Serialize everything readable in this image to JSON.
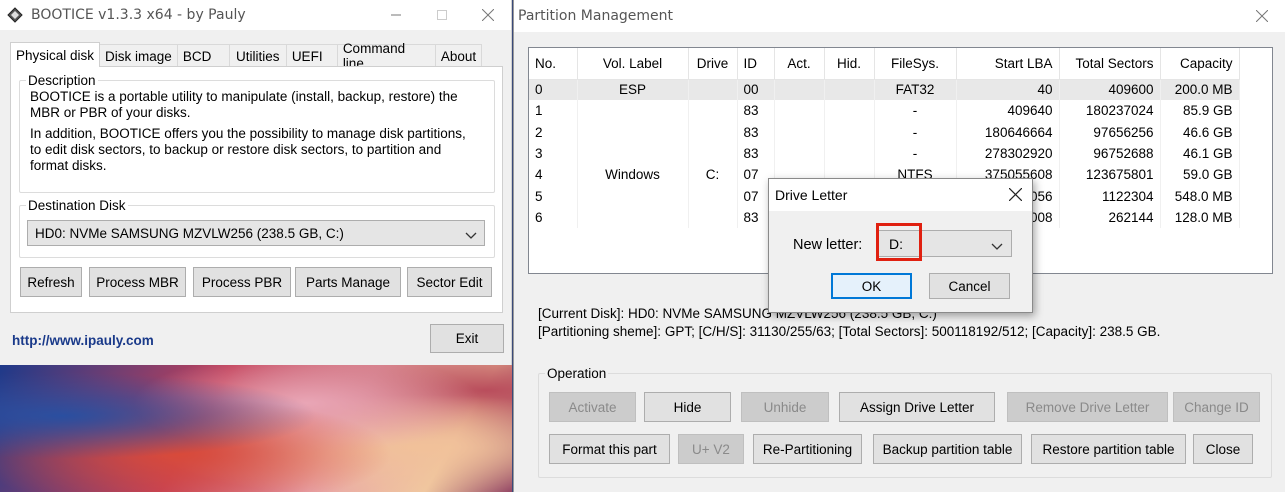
{
  "left_window": {
    "title": "BOOTICE v1.3.3 x64 - by Pauly",
    "tabs": [
      {
        "label": "Physical disk",
        "active": true
      },
      {
        "label": "Disk image"
      },
      {
        "label": "BCD"
      },
      {
        "label": "Utilities"
      },
      {
        "label": "UEFI"
      },
      {
        "label": "Command line"
      },
      {
        "label": "About"
      }
    ],
    "description_legend": "Description",
    "description_p1": "BOOTICE is a portable utility to manipulate (install, backup, restore) the MBR or PBR of your disks.",
    "description_p2": "In addition, BOOTICE offers you the possibility to manage disk partitions, to edit disk sectors, to backup or restore disk sectors, to partition and format disks.",
    "destination_legend": "Destination Disk",
    "destination_value": "HD0: NVMe SAMSUNG MZVLW256 (238.5 GB, C:)",
    "buttons": {
      "refresh": "Refresh",
      "process_mbr": "Process MBR",
      "process_pbr": "Process PBR",
      "parts_manage": "Parts Manage",
      "sector_edit": "Sector Edit",
      "exit": "Exit"
    },
    "website": "http://www.ipauly.com"
  },
  "right_window": {
    "title": "Partition Management",
    "columns": [
      "No.",
      "Vol. Label",
      "Drive",
      "ID",
      "Act.",
      "Hid.",
      "FileSys.",
      "Start LBA",
      "Total Sectors",
      "Capacity"
    ],
    "rows": [
      [
        "0",
        "ESP",
        "",
        "00",
        "",
        "",
        "FAT32",
        "40",
        "409600",
        "200.0 MB"
      ],
      [
        "1",
        "",
        "",
        "83",
        "",
        "",
        "-",
        "409640",
        "180237024",
        "85.9 GB"
      ],
      [
        "2",
        "",
        "",
        "83",
        "",
        "",
        "-",
        "180646664",
        "97656256",
        "46.6 GB"
      ],
      [
        "3",
        "",
        "",
        "83",
        "",
        "",
        "-",
        "278302920",
        "96752688",
        "46.1 GB"
      ],
      [
        "4",
        "Windows",
        "C:",
        "07",
        "",
        "",
        "NTFS",
        "375055608",
        "123675801",
        "59.0 GB"
      ],
      [
        "5",
        "",
        "",
        "07",
        "",
        "",
        "",
        "498731056",
        "1122304",
        "548.0 MB"
      ],
      [
        "6",
        "",
        "",
        "83",
        "",
        "",
        "",
        "499853008",
        "262144",
        "128.0 MB"
      ]
    ],
    "info_line1": "[Current Disk]:   HD0: NVMe SAMSUNG MZVLW256 (238.5 GB, C:)",
    "info_line2": "[Partitioning sheme]:    GPT;      [C/H/S]: 31130/255/63; [Total Sectors]: 500118192/512; [Capacity]: 238.5 GB.",
    "operation_legend": "Operation",
    "op_buttons": {
      "activate": "Activate",
      "hide": "Hide",
      "unhide": "Unhide",
      "assign_drive_letter": "Assign Drive Letter",
      "remove_drive_letter": "Remove Drive Letter",
      "change_id": "Change ID",
      "format_this_part": "Format this part",
      "uv2": "U+ V2",
      "re_partitioning": "Re-Partitioning",
      "backup_partition_table": "Backup partition table",
      "restore_partition_table": "Restore partition table",
      "close": "Close"
    }
  },
  "dialog": {
    "title": "Drive Letter",
    "new_letter_label": "New letter:",
    "new_letter_value": "D:",
    "ok": "OK",
    "cancel": "Cancel"
  }
}
